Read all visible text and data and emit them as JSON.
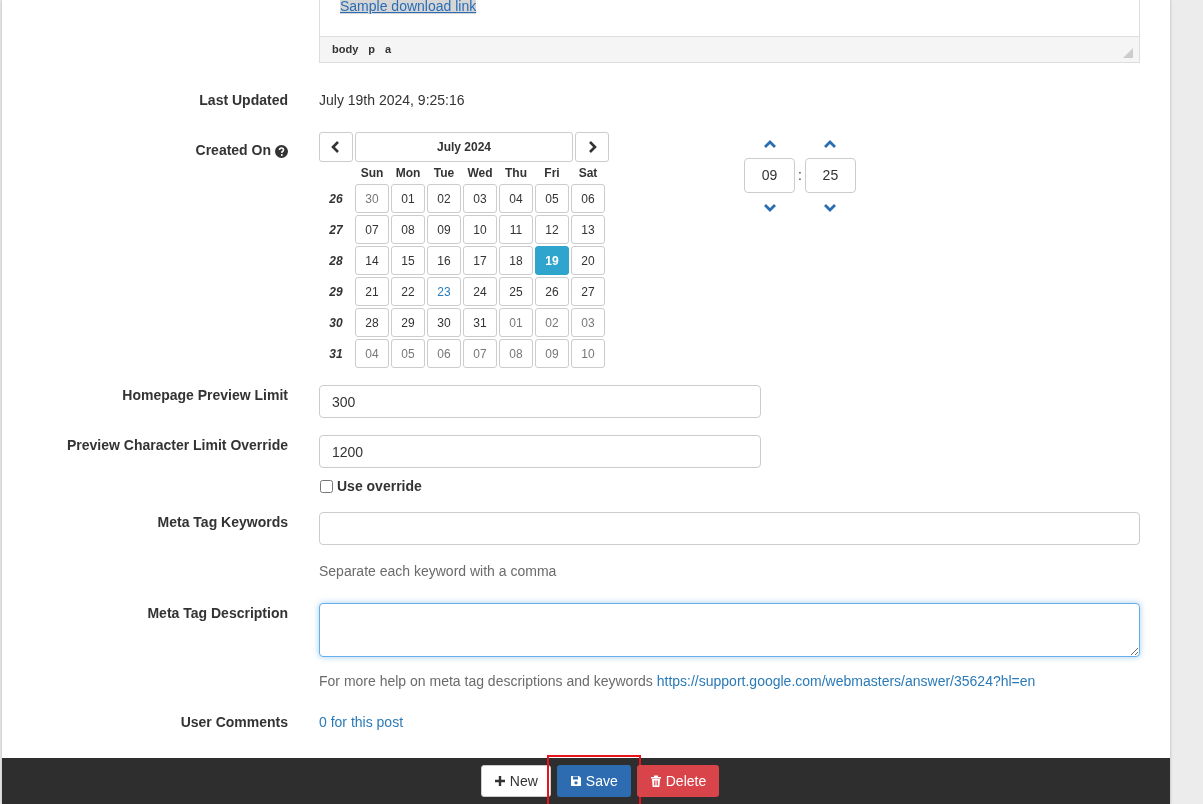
{
  "editor": {
    "link": "Sample download link",
    "link_selected": true,
    "path": [
      "body",
      "p",
      "a"
    ]
  },
  "fields": [
    {
      "kind": "text",
      "label": "Last Updated",
      "value": "July 19th 2024, 9:25:16"
    },
    {
      "kind": "datetime",
      "label": "Created On",
      "help_icon": true,
      "calendar": {
        "title": "July 2024",
        "weekdays": [
          "Sun",
          "Mon",
          "Tue",
          "Wed",
          "Thu",
          "Fri",
          "Sat"
        ],
        "weeks": [
          {
            "week": "26",
            "days": [
              {
                "label": "30",
                "muted": true,
                "today": false,
                "selected": false
              },
              {
                "label": "01",
                "muted": false,
                "today": false,
                "selected": false
              },
              {
                "label": "02",
                "muted": false,
                "today": false,
                "selected": false
              },
              {
                "label": "03",
                "muted": false,
                "today": false,
                "selected": false
              },
              {
                "label": "04",
                "muted": false,
                "today": false,
                "selected": false
              },
              {
                "label": "05",
                "muted": false,
                "today": false,
                "selected": false
              },
              {
                "label": "06",
                "muted": false,
                "today": false,
                "selected": false
              }
            ]
          },
          {
            "week": "27",
            "days": [
              {
                "label": "07",
                "muted": false,
                "today": false,
                "selected": false
              },
              {
                "label": "08",
                "muted": false,
                "today": false,
                "selected": false
              },
              {
                "label": "09",
                "muted": false,
                "today": false,
                "selected": false
              },
              {
                "label": "10",
                "muted": false,
                "today": false,
                "selected": false
              },
              {
                "label": "11",
                "muted": false,
                "today": false,
                "selected": false
              },
              {
                "label": "12",
                "muted": false,
                "today": false,
                "selected": false
              },
              {
                "label": "13",
                "muted": false,
                "today": false,
                "selected": false
              }
            ]
          },
          {
            "week": "28",
            "days": [
              {
                "label": "14",
                "muted": false,
                "today": false,
                "selected": false
              },
              {
                "label": "15",
                "muted": false,
                "today": false,
                "selected": false
              },
              {
                "label": "16",
                "muted": false,
                "today": false,
                "selected": false
              },
              {
                "label": "17",
                "muted": false,
                "today": false,
                "selected": false
              },
              {
                "label": "18",
                "muted": false,
                "today": false,
                "selected": false
              },
              {
                "label": "19",
                "muted": false,
                "today": false,
                "selected": true
              },
              {
                "label": "20",
                "muted": false,
                "today": false,
                "selected": false
              }
            ]
          },
          {
            "week": "29",
            "days": [
              {
                "label": "21",
                "muted": false,
                "today": false,
                "selected": false
              },
              {
                "label": "22",
                "muted": false,
                "today": false,
                "selected": false
              },
              {
                "label": "23",
                "muted": false,
                "today": true,
                "selected": false
              },
              {
                "label": "24",
                "muted": false,
                "today": false,
                "selected": false
              },
              {
                "label": "25",
                "muted": false,
                "today": false,
                "selected": false
              },
              {
                "label": "26",
                "muted": false,
                "today": false,
                "selected": false
              },
              {
                "label": "27",
                "muted": false,
                "today": false,
                "selected": false
              }
            ]
          },
          {
            "week": "30",
            "days": [
              {
                "label": "28",
                "muted": false,
                "today": false,
                "selected": false
              },
              {
                "label": "29",
                "muted": false,
                "today": false,
                "selected": false
              },
              {
                "label": "30",
                "muted": false,
                "today": false,
                "selected": false
              },
              {
                "label": "31",
                "muted": false,
                "today": false,
                "selected": false
              },
              {
                "label": "01",
                "muted": true,
                "today": false,
                "selected": false
              },
              {
                "label": "02",
                "muted": true,
                "today": false,
                "selected": false
              },
              {
                "label": "03",
                "muted": true,
                "today": false,
                "selected": false
              }
            ]
          },
          {
            "week": "31",
            "days": [
              {
                "label": "04",
                "muted": true,
                "today": false,
                "selected": false
              },
              {
                "label": "05",
                "muted": true,
                "today": false,
                "selected": false
              },
              {
                "label": "06",
                "muted": true,
                "today": false,
                "selected": false
              },
              {
                "label": "07",
                "muted": true,
                "today": false,
                "selected": false
              },
              {
                "label": "08",
                "muted": true,
                "today": false,
                "selected": false
              },
              {
                "label": "09",
                "muted": true,
                "today": false,
                "selected": false
              },
              {
                "label": "10",
                "muted": true,
                "today": false,
                "selected": false
              }
            ]
          }
        ]
      },
      "time": {
        "hour": "09",
        "separator": ":",
        "minute": "25"
      }
    },
    {
      "kind": "input",
      "label": "Homepage Preview Limit",
      "value": "300",
      "wide": false
    },
    {
      "kind": "input",
      "label": "Preview Character Limit Override",
      "value": "1200",
      "wide": false,
      "checkbox": {
        "label": "Use override",
        "checked": false
      }
    },
    {
      "kind": "input",
      "label": "Meta Tag Keywords",
      "wide": true,
      "help": "Separate each keyword with a comma"
    },
    {
      "kind": "textarea",
      "label": "Meta Tag Description",
      "focused": true,
      "help": "For more help on meta tag descriptions and keywords ",
      "help_link": "https://support.google.com/webmasters/answer/35624?hl=en"
    },
    {
      "kind": "link",
      "label": "User Comments",
      "value": "0 for this post"
    }
  ],
  "buttons": [
    {
      "kind": "new",
      "label": "New",
      "highlighted": false
    },
    {
      "kind": "save",
      "label": "Save",
      "highlighted": true
    },
    {
      "kind": "delete",
      "label": "Delete",
      "highlighted": false
    }
  ]
}
